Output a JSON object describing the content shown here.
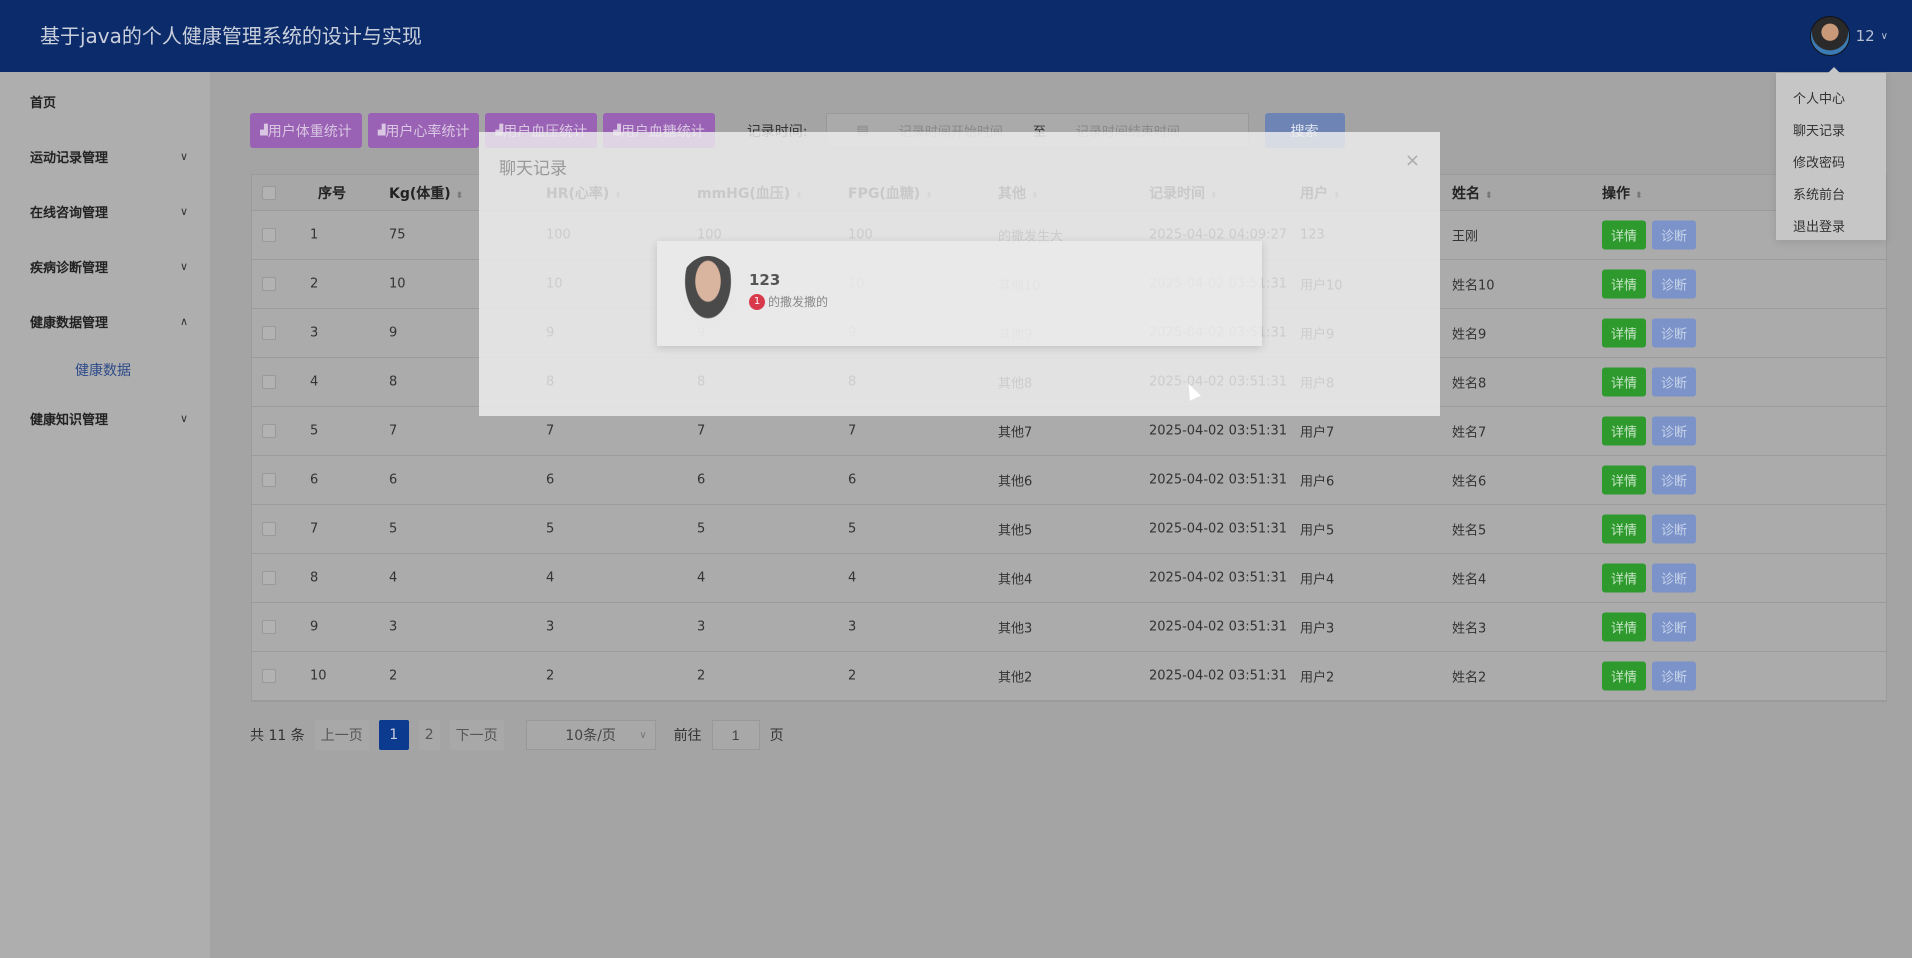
{
  "header": {
    "title": "基于java的个人健康管理系统的设计与实现",
    "username": "12"
  },
  "user_menu": [
    "个人中心",
    "聊天记录",
    "修改密码",
    "系统前台",
    "退出登录"
  ],
  "sidebar": {
    "items": [
      {
        "label": "首页",
        "expandable": false
      },
      {
        "label": "运动记录管理",
        "expandable": true,
        "expanded": false
      },
      {
        "label": "在线咨询管理",
        "expandable": true,
        "expanded": false
      },
      {
        "label": "疾病诊断管理",
        "expandable": true,
        "expanded": false
      },
      {
        "label": "健康数据管理",
        "expandable": true,
        "expanded": true,
        "children": [
          "健康数据"
        ]
      },
      {
        "label": "健康知识管理",
        "expandable": true,
        "expanded": false
      }
    ]
  },
  "toolbar": {
    "buttons": [
      "用户体重统计",
      "用户心率统计",
      "用户血压统计",
      "用户血糖统计"
    ],
    "record_time_label": "记录时间:",
    "start_placeholder": "记录时间开始时间",
    "separator": "至",
    "end_placeholder": "记录时间结束时间",
    "search_label": "搜索"
  },
  "table": {
    "columns": [
      "序号",
      "Kg(体重)",
      "HR(心率)",
      "mmHG(血压)",
      "FPG(血糖)",
      "其他",
      "记录时间",
      "用户",
      "姓名",
      "操作"
    ],
    "rows": [
      [
        "1",
        "75",
        "100",
        "100",
        "100",
        "的撒发生大",
        "2025-04-02 04:09:27",
        "123",
        "王刚"
      ],
      [
        "2",
        "10",
        "10",
        "10",
        "10",
        "其他10",
        "2025-04-02 03:51:31",
        "用户10",
        "姓名10"
      ],
      [
        "3",
        "9",
        "9",
        "9",
        "9",
        "其他9",
        "2025-04-02 03:51:31",
        "用户9",
        "姓名9"
      ],
      [
        "4",
        "8",
        "8",
        "8",
        "8",
        "其他8",
        "2025-04-02 03:51:31",
        "用户8",
        "姓名8"
      ],
      [
        "5",
        "7",
        "7",
        "7",
        "7",
        "其他7",
        "2025-04-02 03:51:31",
        "用户7",
        "姓名7"
      ],
      [
        "6",
        "6",
        "6",
        "6",
        "6",
        "其他6",
        "2025-04-02 03:51:31",
        "用户6",
        "姓名6"
      ],
      [
        "7",
        "5",
        "5",
        "5",
        "5",
        "其他5",
        "2025-04-02 03:51:31",
        "用户5",
        "姓名5"
      ],
      [
        "8",
        "4",
        "4",
        "4",
        "4",
        "其他4",
        "2025-04-02 03:51:31",
        "用户4",
        "姓名4"
      ],
      [
        "9",
        "3",
        "3",
        "3",
        "3",
        "其他3",
        "2025-04-02 03:51:31",
        "用户3",
        "姓名3"
      ],
      [
        "10",
        "2",
        "2",
        "2",
        "2",
        "其他2",
        "2025-04-02 03:51:31",
        "用户2",
        "姓名2"
      ]
    ],
    "actions": [
      "详情",
      "诊断"
    ]
  },
  "pagination": {
    "total": "共 11 条",
    "prev": "上一页",
    "pages": [
      "1",
      "2"
    ],
    "current": "1",
    "next": "下一页",
    "page_size": "10条/页",
    "goto_label": "前往",
    "goto_value": "1",
    "page_suffix": "页"
  },
  "chat_modal": {
    "title": "聊天记录",
    "close": "×",
    "contact": {
      "name": "123",
      "unread": "1",
      "last_message": "的撒发撒的"
    }
  },
  "colors": {
    "header": "#0c2b6b",
    "stat_button": "#9a62b4",
    "detail_button": "#2e9a2e",
    "diagnose_button": "#7b93c9",
    "active_page": "#0c3a8e",
    "unread_badge": "#d93a4b"
  }
}
